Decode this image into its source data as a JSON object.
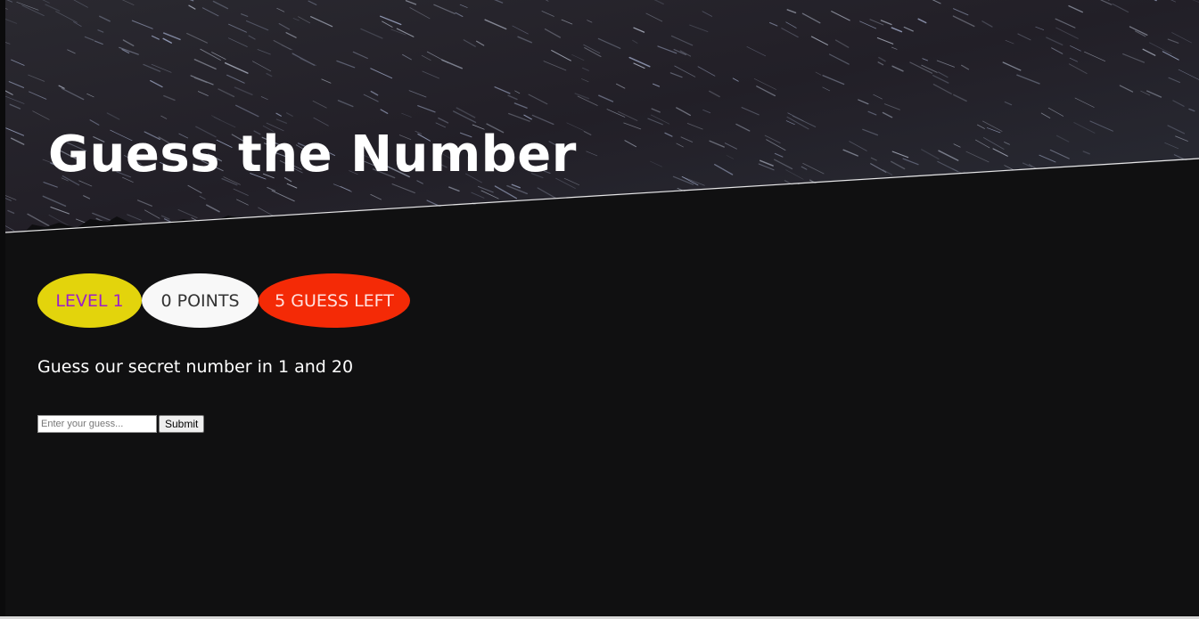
{
  "header": {
    "title": "Guess the Number"
  },
  "stats": {
    "level_label": "LEVEL 1",
    "points_label": "0 POINTS",
    "guesses_label": "5 GUESS LEFT",
    "colors": {
      "level_bg": "#e3d40c",
      "level_text": "#9b1fc9",
      "points_bg": "#f8f8f8",
      "points_text": "#333333",
      "guesses_bg": "#f42a06",
      "guesses_text": "#ffe2e0"
    }
  },
  "game": {
    "prompt": "Guess our secret number in 1 and 20",
    "input_placeholder": "Enter your guess...",
    "input_value": "",
    "submit_label": "Submit"
  },
  "theme": {
    "page_bg": "#101011",
    "hero_bg": "#24232a",
    "title_color": "#ffffff"
  }
}
